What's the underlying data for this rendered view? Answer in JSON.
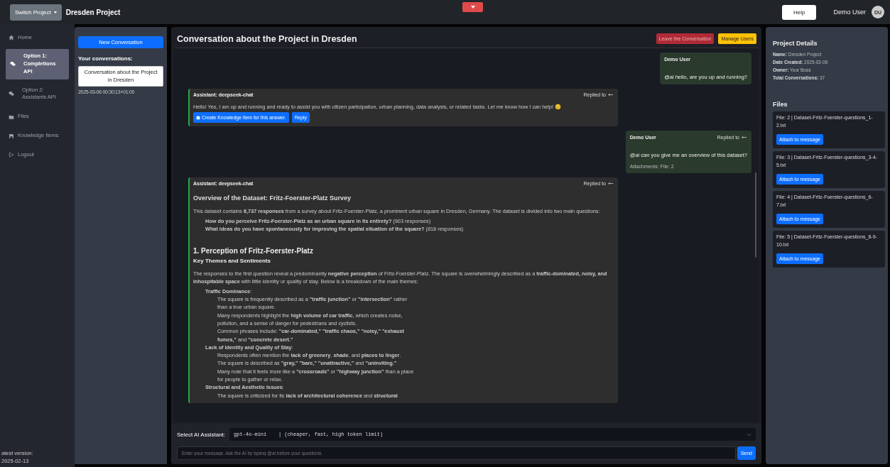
{
  "topbar": {
    "switch_button": "Switch Project",
    "project_title": "Dresden Project",
    "help_button": "Help",
    "user_name": "Demo User",
    "avatar_initials": "DU"
  },
  "sidebar": {
    "items": [
      {
        "label": "Home",
        "kind": "home",
        "selected": false
      },
      {
        "label": "Option 1: Completions API",
        "kind": "chat",
        "selected": true
      },
      {
        "label": "Option 2: Assistants API",
        "kind": "chat",
        "selected": false
      },
      {
        "label": "Files",
        "kind": "folder",
        "selected": false
      },
      {
        "label": "Knowledge Items",
        "kind": "save",
        "selected": false
      },
      {
        "label": "Logout",
        "kind": "logout",
        "selected": false
      }
    ],
    "version_label": "atest version:",
    "version": "2025-02-13"
  },
  "conversations": {
    "new_button": "New Conversation",
    "heading": "Your conversations:",
    "items": [
      {
        "title": "Conversation about the Project in Dresden",
        "timestamp": "2025-03-06 00:30:13+01:00",
        "selected": true
      }
    ]
  },
  "conversation": {
    "title": "Conversation about the Project in Dresden",
    "leave_button": "Leave the Conversation",
    "manage_button": "Manage Users",
    "messages": [
      {
        "kind": "user",
        "author": "Demo User",
        "text": "@ai hello, are you up and running?"
      },
      {
        "kind": "assistant",
        "author": "Assistant: deepseek-chat",
        "replied_to": "Replied to",
        "blocks": [
          {
            "kind": "paragraph",
            "text": "Hello! Yes, I am up and running and ready to assist you with citizen participation, urban planning, data analysis, or related tasks. Let me know how I can help! 😊"
          }
        ],
        "knowledge_button": "Create Knowledge Item for this answer.",
        "reply_button": "Reply"
      },
      {
        "kind": "user",
        "author": "Demo User",
        "replied_to": "Replied to",
        "text": "@ai can you give me an overview of this dataset?",
        "attachments_label": "Attachments:",
        "attachments": "File: 2"
      },
      {
        "kind": "assistant",
        "author": "Assistant: deepseek-chat",
        "replied_to": "Replied to",
        "blocks": [
          {
            "kind": "heading3",
            "text": "Overview of the Dataset: Fritz-Foerster-Platz Survey"
          },
          {
            "kind": "paragraph",
            "text": "This dataset contains **6,737 responses** from a survey about Fritz-Foerster-Platz, a prominent urban square in Dresden, Germany. The dataset is divided into two main questions:"
          },
          {
            "kind": "item",
            "text": "**How do you perceive Fritz-Foerster-Platz as an urban square in its entirety?** (903 responses)"
          },
          {
            "kind": "item",
            "text": "**What ideas do you have spontaneously for improving the spatial situation of the square?** (818 responses)"
          },
          {
            "kind": "heading2",
            "text": "1. Perception of Fritz-Foerster-Platz"
          },
          {
            "kind": "heading4",
            "text": "Key Themes and Sentiments"
          },
          {
            "kind": "paragraph",
            "text": "The responses to the first question reveal a predominantly **negative perception** of Fritz-Foerster-Platz. The square is overwhelmingly described as a **traffic-dominated, noisy, and inhospitable space** with little identity or quality of stay. Below is a breakdown of the main themes:"
          },
          {
            "kind": "item",
            "text": "**Traffic Dominance**:",
            "children": [
              {
                "kind": "item",
                "text": "The square is frequently described as a **\"traffic junction\"** or **\"intersection\"** rather than a true urban square."
              },
              {
                "kind": "item",
                "text": "Many respondents highlight the **high volume of car traffic**, which creates noise, pollution, and a sense of danger for pedestrians and cyclists."
              },
              {
                "kind": "item",
                "text": "Common phrases include: **\"car-dominated,\" \"traffic chaos,\" \"noisy,\" \"exhaust fumes,\"** and **\"concrete desert.\"**"
              }
            ]
          },
          {
            "kind": "item",
            "text": "**Lack of Identity and Quality of Stay**:",
            "children": [
              {
                "kind": "item",
                "text": "Respondents often mention the **lack of greenery**, **shade**, and **places to linger**."
              },
              {
                "kind": "item",
                "text": "The square is described as **\"gray,\" \"bare,\" \"unattractive,\"** and **\"uninviting.\"**"
              },
              {
                "kind": "item",
                "text": "Many note that it feels more like a **\"crossroads\"** or **\"highway junction\"** than a place for people to gather or relax."
              }
            ]
          },
          {
            "kind": "item",
            "text": "**Structural and Aesthetic Issues**:",
            "children": [
              {
                "kind": "item",
                "text": "The square is criticized for its **lack of architectural coherence** and **structural**"
              }
            ]
          }
        ]
      }
    ],
    "assistant_label": "Select AI Assistant:",
    "assistant_value": "gpt-4o-mini    | (cheaper, fast, high token limit)",
    "message_placeholder": "Enter your message. Ask the AI by typing @ai before your questions.",
    "send_button": "Send"
  },
  "project": {
    "heading": "Project Details",
    "details": [
      {
        "label": "Name:",
        "value": "Dresden Project"
      },
      {
        "label": "Date Created:",
        "value": "2025-02-06"
      },
      {
        "label": "Owner:",
        "value": "Your Boss"
      },
      {
        "label": "Total Conversations:",
        "value": "37"
      }
    ],
    "files_heading": "Files",
    "files": [
      {
        "name": "File: 2 | Dataset-Fritz-Foerster-questions_1-2.txt",
        "button": "Attach to message"
      },
      {
        "name": "File: 3 | Dataset-Fritz-Foerster-questions_3-4-5.txt",
        "button": "Attach to message"
      },
      {
        "name": "File: 4 | Dataset-Fritz-Foerster-questions_6-7.txt",
        "button": "Attach to message"
      },
      {
        "name": "File: 5 | Dataset-Fritz-Foerster-questions_8-9-10.txt",
        "button": "Attach to message"
      }
    ]
  }
}
